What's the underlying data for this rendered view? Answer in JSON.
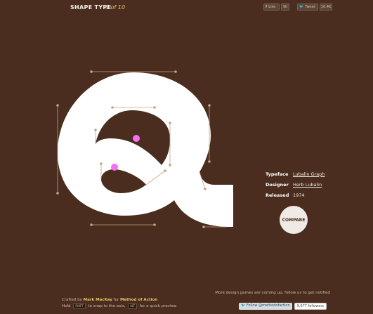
{
  "header": {
    "title": "SHAPE TYPE",
    "counter": "1 of 10"
  },
  "social": {
    "like_label": "Like",
    "like_count": "9k",
    "tweet_label": "Tweet",
    "tweet_count": "10.4K"
  },
  "glyph": {
    "letter": "Q",
    "active_handle_color": "#f76ff2",
    "guide_color": "#c9a27e"
  },
  "info": {
    "typeface_label": "Typeface",
    "typeface_value": "Lubalin Graph",
    "designer_label": "Designer",
    "designer_value": "Herb Lubalin",
    "released_label": "Released",
    "released_value": "1974"
  },
  "compare_label": "COMPARE",
  "footer": {
    "crafted_prefix": "Crafted by",
    "author": "Mark MacKay",
    "for_word": "for",
    "studio": "Method of Action",
    "hold_text": "Hold",
    "shift_key": "SHIFT",
    "snap_text": "to snap to the axis,",
    "alt_key": "ALT",
    "preview_text": "for a quick preview",
    "more_games": "More design games are coming up, follow us to get notified",
    "follow_label": "Follow @methodofaction",
    "followers_count": "9,677 followers"
  },
  "colors": {
    "background": "#4a2d1e",
    "accent": "#e9c46a",
    "shape_fill": "#ffffff"
  }
}
